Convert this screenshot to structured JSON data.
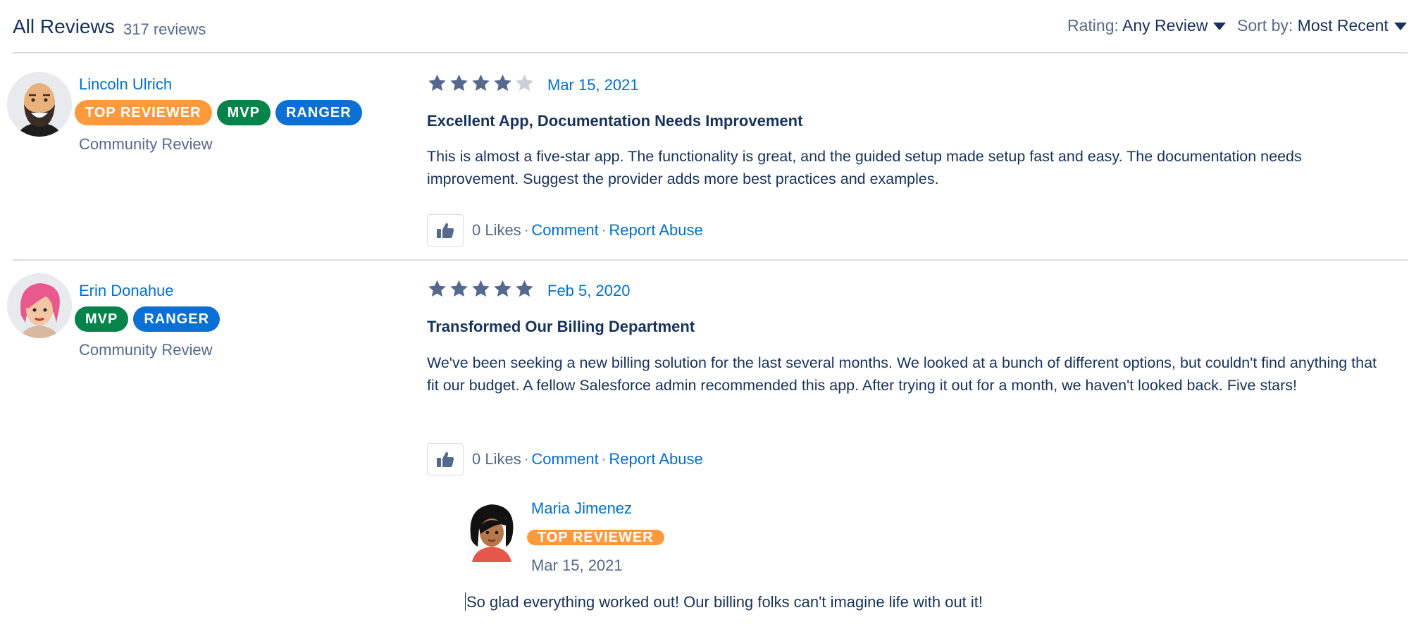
{
  "header": {
    "title": "All Reviews",
    "count": "317 reviews",
    "rating_label": "Rating:",
    "rating_value": "Any Review",
    "sort_label": "Sort by:",
    "sort_value": "Most Recent"
  },
  "reviews": [
    {
      "name": "Lincoln Ulrich",
      "badges": [
        "TOP REVIEWER",
        "MVP",
        "RANGER"
      ],
      "type": "Community Review",
      "rating": 4,
      "date": "Mar 15, 2021",
      "title": "Excellent App, Documentation Needs Improvement",
      "body": "This is almost a five-star app. The functionality is great, and the guided setup made setup fast and easy. The documentation needs improvement. Suggest the provider adds more best practices and examples.",
      "likes": "0 Likes",
      "comment": "Comment",
      "report": "Report Abuse"
    },
    {
      "name": "Erin Donahue",
      "badges": [
        "MVP",
        "RANGER"
      ],
      "type": "Community Review",
      "rating": 5,
      "date": "Feb 5, 2020",
      "title": "Transformed Our Billing Department",
      "body": "We've been seeking a new billing solution for the last several months. We looked at a bunch of different options, but couldn't find anything that fit our budget. A fellow Salesforce admin recommended this app. After trying it out for a month, we haven't looked back. Five stars!",
      "likes": "0 Likes",
      "comment": "Comment",
      "report": "Report Abuse",
      "reply": {
        "name": "Maria Jimenez",
        "badge": "TOP REVIEWER",
        "date": "Mar 15, 2021",
        "body": "So glad everything worked out! Our billing folks can't imagine life with out it!"
      }
    }
  ],
  "colors": {
    "link": "#0070d2",
    "text": "#16325c",
    "muted": "#54698d",
    "star_filled": "#54698d",
    "star_empty": "#c9d0da",
    "badge_top": "#ff9a3c",
    "badge_mvp": "#04844b",
    "badge_ranger": "#0b6fd3"
  },
  "icons": {
    "dropdown": "caret-down-icon",
    "like": "thumbs-up-icon",
    "star": "star-icon"
  }
}
